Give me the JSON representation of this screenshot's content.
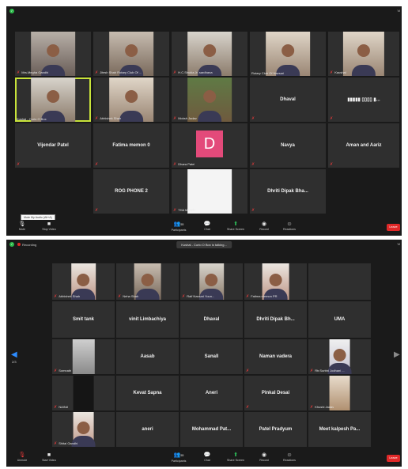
{
  "shot1": {
    "view_label": "Vi",
    "tiles": [
      {
        "label": "Mrs.Megha Gandhi",
        "center": ""
      },
      {
        "label": "Jitesh Shah Rotary Club Of ...",
        "center": ""
      },
      {
        "label": "H.C.Shukla Jr. sardhana",
        "center": ""
      },
      {
        "label": "Rotary Club Of Navsari",
        "center": ""
      },
      {
        "label": "Kaushal",
        "center": ""
      },
      {
        "label": "Kushal - Curio O Box",
        "center": ""
      },
      {
        "label": "Abhishek Shah",
        "center": ""
      },
      {
        "label": "Moksh Jadav",
        "center": ""
      },
      {
        "label": "",
        "center": "Dhaval"
      },
      {
        "label": "",
        "center": "▮▮▮▮▮ ▯▯▯▯ ▮..."
      },
      {
        "label": "",
        "center": "Vijendar Patel"
      },
      {
        "label": "",
        "center": "Fatima memon 0"
      },
      {
        "label": "Dhara Patel",
        "center": ""
      },
      {
        "label": "",
        "center": "Navya"
      },
      {
        "label": "",
        "center": "Aman and Aariz"
      },
      {
        "label": "",
        "center": "ROG PHONE 2"
      },
      {
        "label": "THA MANSI",
        "center": ""
      },
      {
        "label": "",
        "center": "Dhriti Dipak Bha..."
      }
    ],
    "avatar_letter": "D",
    "tooltip": "Mute My Audio (Alt+A)",
    "toolbar": {
      "mute": "Mute",
      "stop_video": "Stop Video",
      "participants": "Participants",
      "participants_count": "55",
      "chat": "Chat",
      "share_screen": "Share Screen",
      "record": "Record",
      "reactions": "Reactions",
      "end": "Leave"
    }
  },
  "shot2": {
    "recording": "Recording",
    "talking": "Kushal - Curio O Box is talking...",
    "view_label": "Vi",
    "page_left": "2/3",
    "tiles": [
      {
        "label": "Abhishek Shah",
        "center": ""
      },
      {
        "label": "Neha Shah",
        "center": ""
      },
      {
        "label": "Ralf Navsari Youn...",
        "center": ""
      },
      {
        "label": "Fatima memon PR",
        "center": ""
      },
      {
        "label": "",
        "center": ""
      },
      {
        "label": "",
        "center": "Smit tank"
      },
      {
        "label": "",
        "center": "vinit Limbachiya"
      },
      {
        "label": "",
        "center": "Dhaval"
      },
      {
        "label": "",
        "center": "Dhriti Dipak Bh..."
      },
      {
        "label": "",
        "center": "UMA"
      },
      {
        "label": "Somnath",
        "center": ""
      },
      {
        "label": "",
        "center": "Aasab"
      },
      {
        "label": "",
        "center": "Sanall"
      },
      {
        "label": "",
        "center": "Naman vadera"
      },
      {
        "label": "Rtr.Surbhi Jodhani ...",
        "center": ""
      },
      {
        "label": "NAINA",
        "center": ""
      },
      {
        "label": "",
        "center": "Kevat Sapna"
      },
      {
        "label": "",
        "center": "Aneri"
      },
      {
        "label": "",
        "center": "Pinkal Desai"
      },
      {
        "label": "Khushi Jadav",
        "center": ""
      },
      {
        "label": "Shital Gandhi",
        "center": ""
      },
      {
        "label": "",
        "center": "aneri"
      },
      {
        "label": "",
        "center": "Mohammad Pat..."
      },
      {
        "label": "",
        "center": "Patel Pradyum"
      },
      {
        "label": "",
        "center": "Meet kalpesh Pa..."
      }
    ],
    "toolbar": {
      "unmute": "Unmute",
      "start_video": "Start Video",
      "participants": "Participants",
      "participants_count": "55",
      "chat": "Chat",
      "share_screen": "Share Screen",
      "record": "Record",
      "reactions": "Reactions",
      "end": "Leave"
    }
  }
}
